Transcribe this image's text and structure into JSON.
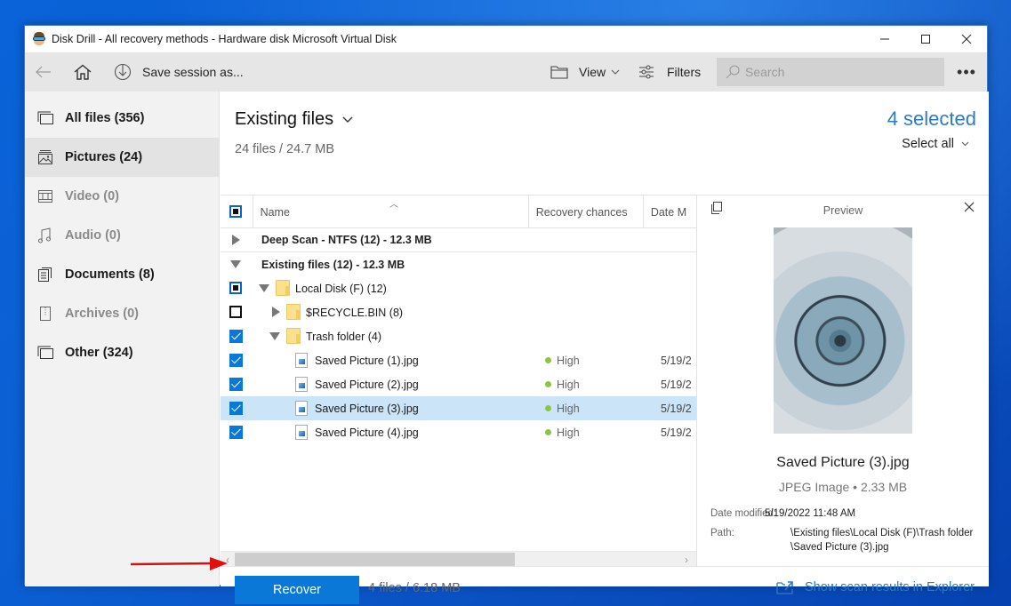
{
  "window": {
    "title": "Disk Drill - All recovery methods - Hardware disk Microsoft Virtual Disk",
    "controls": {
      "minimize": "—",
      "maximize": "☐",
      "close": "✕"
    }
  },
  "toolbar": {
    "back_icon": "arrow-left-icon",
    "home_icon": "home-icon",
    "save_session_label": "Save session as...",
    "view_label": "View",
    "filters_label": "Filters",
    "search_placeholder": "Search",
    "more_label": "•••"
  },
  "sidebar": {
    "items": [
      {
        "label": "All files (356)",
        "icon": "all-files-icon",
        "state": "normal"
      },
      {
        "label": "Pictures (24)",
        "icon": "pictures-icon",
        "state": "active"
      },
      {
        "label": "Video (0)",
        "icon": "video-icon",
        "state": "disabled"
      },
      {
        "label": "Audio (0)",
        "icon": "audio-icon",
        "state": "disabled"
      },
      {
        "label": "Documents (8)",
        "icon": "documents-icon",
        "state": "normal"
      },
      {
        "label": "Archives (0)",
        "icon": "archives-icon",
        "state": "disabled"
      },
      {
        "label": "Other (324)",
        "icon": "other-icon",
        "state": "normal"
      }
    ]
  },
  "main": {
    "heading": "Existing files",
    "subheading": "24 files / 24.7 MB",
    "selected_count": "4 selected",
    "select_all_label": "Select all"
  },
  "table": {
    "columns": [
      "Name",
      "Recovery chances",
      "Date M"
    ],
    "rows": [
      {
        "type": "group",
        "label": "Deep Scan - NTFS (12) - 12.3 MB",
        "expanded": false
      },
      {
        "type": "group",
        "label": "Existing files (12) - 12.3 MB",
        "expanded": true
      },
      {
        "type": "folder",
        "label": "Local Disk (F) (12)",
        "checkbox": "partial",
        "expanded": true
      },
      {
        "type": "folder",
        "label": "$RECYCLE.BIN (8)",
        "checkbox": "unchecked",
        "expanded": false
      },
      {
        "type": "folder",
        "label": "Trash folder (4)",
        "checkbox": "checked",
        "expanded": true
      },
      {
        "type": "file",
        "label": "Saved Picture (1).jpg",
        "checkbox": "checked",
        "recovery": "High",
        "date": "5/19/2"
      },
      {
        "type": "file",
        "label": "Saved Picture (2).jpg",
        "checkbox": "checked",
        "recovery": "High",
        "date": "5/19/2"
      },
      {
        "type": "file",
        "label": "Saved Picture (3).jpg",
        "checkbox": "checked",
        "recovery": "High",
        "date": "5/19/2",
        "highlighted": true
      },
      {
        "type": "file",
        "label": "Saved Picture (4).jpg",
        "checkbox": "checked",
        "recovery": "High",
        "date": "5/19/2"
      }
    ],
    "recovery_color": "#8cc63f"
  },
  "preview": {
    "title": "Preview",
    "file_name": "Saved Picture (3).jpg",
    "file_type": "JPEG Image • 2.33 MB",
    "date_label": "Date modified:",
    "date_value": "5/19/2022 11:48 AM",
    "path_label": "Path:",
    "path_line1": "\\Existing files\\Local Disk (F)\\Trash folder",
    "path_line2": "\\Saved Picture (3).jpg"
  },
  "footer": {
    "recover_label": "Recover",
    "summary": "4 files / 6.18 MB",
    "explorer_link": "Show scan results in Explorer"
  },
  "colors": {
    "accent": "#0a78d7",
    "link": "#2d7bc5",
    "annotation_arrow": "#e01010"
  }
}
